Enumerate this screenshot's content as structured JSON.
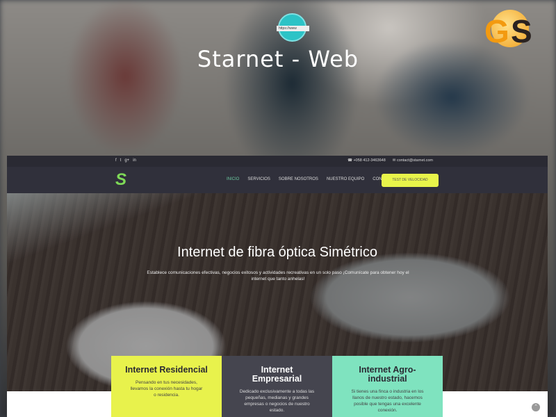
{
  "overlay": {
    "title": "Starnet - Web",
    "globe_label": "https://www",
    "badge": "GS"
  },
  "topbar": {
    "social": [
      "f",
      "t",
      "g+",
      "in"
    ],
    "phone": "+058 412-3463648",
    "email": "contact@starnet.com"
  },
  "nav": {
    "logo": "S",
    "items": [
      "INICIO",
      "SERVICIOS",
      "SOBRE NOSOTROS",
      "NUESTRO EQUIPO",
      "CONTACTO"
    ],
    "active": "INICIO",
    "cta": "TEST DE VELOCIDAD"
  },
  "hero": {
    "title": "Internet de fibra óptica Simétrico",
    "text": "Establece comunicaciones efectivas, negocios exitosos y actividades recreativas en un solo paso ¡Comunícate para obtener hoy el internet que tanto anhelas!"
  },
  "cards": [
    {
      "title": "Internet Residencial",
      "text": "Pensando en tus necesidades, llevamos la conexión hasta tu hogar o residencia."
    },
    {
      "title": "Internet Empresarial",
      "text": "Dedicado exclusivamente a todas las pequeñas, medianas y grandes empresas o negocios de nuestro estado."
    },
    {
      "title": "Internet Agro-industrial",
      "text": "Si tienes una finca o industria en los llanos de nuestro estado, hacemos posible que tengas una excelente conexión."
    }
  ],
  "colors": {
    "yellow": "#e8f24c",
    "dark": "#45454f",
    "teal": "#7fe3bf",
    "active": "#6cc9a0"
  }
}
